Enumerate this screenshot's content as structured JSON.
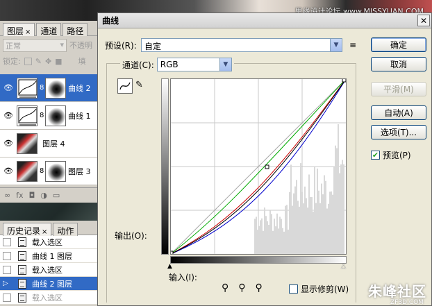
{
  "watermark_top": "思缘设计论坛 www.MISSYUAN.COM",
  "watermark_bottom": "朱峰社区",
  "watermark_bottom_sub": "ZF3D.COM",
  "layers_panel": {
    "tabs": [
      "图层",
      "通道",
      "路径"
    ],
    "tab_close": "×",
    "blend_mode": "正常",
    "opacity_label": "不透明",
    "lock_label": "锁定:",
    "fill_label": "填",
    "layers": [
      {
        "name": "曲线 2",
        "type": "curve",
        "selected": true
      },
      {
        "name": "曲线 1",
        "type": "curve",
        "selected": false
      },
      {
        "name": "图层 4",
        "type": "photo",
        "selected": false
      },
      {
        "name": "图层 3",
        "type": "photo-mask",
        "selected": false
      }
    ]
  },
  "history_panel": {
    "tabs": [
      "历史记录",
      "动作"
    ],
    "tab_close": "×",
    "items": [
      {
        "label": "载入选区",
        "selected": false
      },
      {
        "label": "曲线 1 图层",
        "selected": false
      },
      {
        "label": "载入选区",
        "selected": false
      },
      {
        "label": "曲线 2 图层",
        "selected": true
      },
      {
        "label": "载入选区",
        "selected": false
      }
    ]
  },
  "dialog": {
    "title": "曲线",
    "preset_label": "预设(R):",
    "preset_value": "自定",
    "channel_label": "通道(C):",
    "channel_value": "RGB",
    "output_label": "输出(O):",
    "input_label": "输入(I):",
    "show_clipping_label": "显示修剪(W)",
    "show_clipping_checked": false,
    "buttons": {
      "ok": "确定",
      "cancel": "取消",
      "smooth": "平滑(M)",
      "auto": "自动(A)",
      "options": "选项(T)..."
    },
    "preview_label": "预览(P)",
    "preview_checked": true,
    "curves": [
      {
        "name": "RGB",
        "color": "#000000"
      },
      {
        "name": "Red",
        "color": "#cc0000"
      },
      {
        "name": "Green",
        "color": "#00aa00"
      },
      {
        "name": "Blue",
        "color": "#0000cc"
      }
    ]
  }
}
